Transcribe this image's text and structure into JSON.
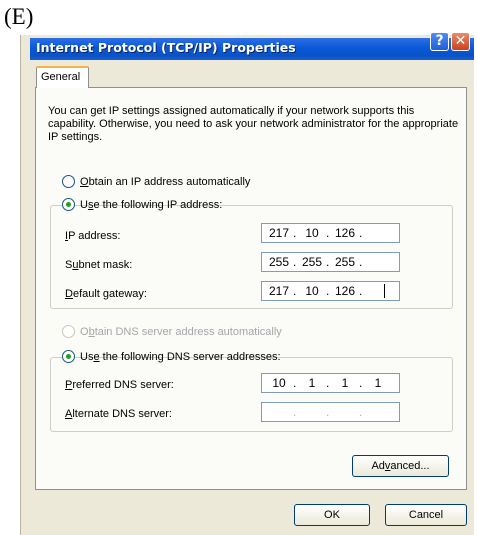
{
  "figure_label": "(E)",
  "window": {
    "title": "Internet Protocol (TCP/IP) Properties",
    "help_button": "?",
    "close_button": "✕"
  },
  "tabs": [
    {
      "label": "General",
      "selected": true
    }
  ],
  "intro_text": "You can get IP settings assigned automatically if your network supports this capability. Otherwise, you need to ask your network administrator for the appropriate IP settings.",
  "ip_section": {
    "obtain_auto": {
      "label": "Obtain an IP address automatically",
      "checked": false
    },
    "use_following": {
      "label": "Use the following IP address:",
      "checked": true
    },
    "fields": [
      {
        "label": "IP address:",
        "octets": [
          "217",
          "10",
          "126",
          ""
        ]
      },
      {
        "label": "Subnet mask:",
        "octets": [
          "255",
          "255",
          "255",
          ""
        ]
      },
      {
        "label": "Default gateway:",
        "octets": [
          "217",
          "10",
          "126",
          ""
        ]
      }
    ]
  },
  "dns_section": {
    "obtain_auto": {
      "label": "Obtain DNS server address automatically",
      "checked": false,
      "enabled": false
    },
    "use_following": {
      "label": "Use the following DNS server addresses:",
      "checked": true
    },
    "fields": [
      {
        "label": "Preferred DNS server:",
        "octets": [
          "10",
          "1",
          "1",
          "1"
        ]
      },
      {
        "label": "Alternate DNS server:",
        "octets": [
          "",
          "",
          "",
          ""
        ]
      }
    ]
  },
  "buttons": {
    "advanced": "Advanced...",
    "ok": "OK",
    "cancel": "Cancel"
  },
  "colors": {
    "titlebar": "#0a58d8",
    "dialog_bg": "#ece9d8",
    "tab_highlight": "#f7b347",
    "radio_dot": "#21a121"
  }
}
